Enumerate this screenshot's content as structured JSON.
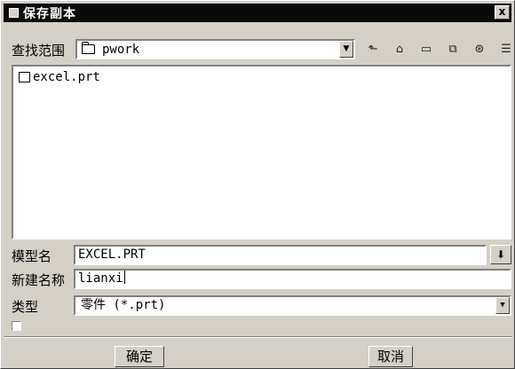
{
  "dialog": {
    "title": "保存副本",
    "close_label": "x"
  },
  "lookin": {
    "label": "查找范围",
    "value": "pwork"
  },
  "toolbar_icons": [
    "up-folder-icon",
    "open-icon",
    "new-folder-icon",
    "new-item-icon",
    "working-dir-icon",
    "view-list-icon"
  ],
  "file_list": {
    "items": [
      {
        "name": "excel.prt"
      }
    ]
  },
  "model_name": {
    "label": "模型名",
    "value": "EXCEL.PRT"
  },
  "new_name": {
    "label": "新建名称",
    "value": "lianxi"
  },
  "type": {
    "label": "类型",
    "value": "零件 (*.prt)"
  },
  "checkbox": {
    "checked": false
  },
  "buttons": {
    "ok": "确定",
    "cancel": "取消"
  }
}
